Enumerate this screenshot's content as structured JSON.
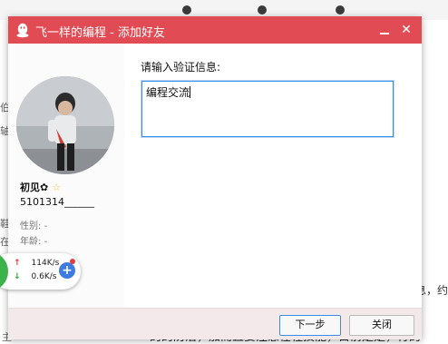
{
  "window": {
    "title": "飞一样的编程 - 添加好友",
    "accent_color": "#e14b54",
    "icons": [
      "qq-penguin-icon",
      "minimize-icon",
      "close-icon"
    ],
    "close_symbol": "✕"
  },
  "profile": {
    "nickname": "初见",
    "nickname_badge": "✿",
    "vip_star": "☆",
    "qq_number": "5101314______",
    "gender_label": "性别:",
    "gender_value": "-",
    "age_label": "年龄:",
    "age_value": "-"
  },
  "form": {
    "prompt": "请输入验证信息:",
    "verify_message": "编程交流"
  },
  "footer": {
    "next_label": "下一步",
    "close_label": "关闭"
  },
  "speed_widget": {
    "upload": "114K/s",
    "download": "0.6K/s",
    "up_arrow": "↑",
    "down_arrow": "↓",
    "plus": "+"
  },
  "background": {
    "left_fragments": [
      "伯",
      "轴",
      "鞋",
      "在"
    ],
    "right_fragment": "息，约",
    "bottom_fragment": "的的防治，加而且要注意在程技能，目前是是，行的",
    "bottom_left_fragment": "主"
  }
}
